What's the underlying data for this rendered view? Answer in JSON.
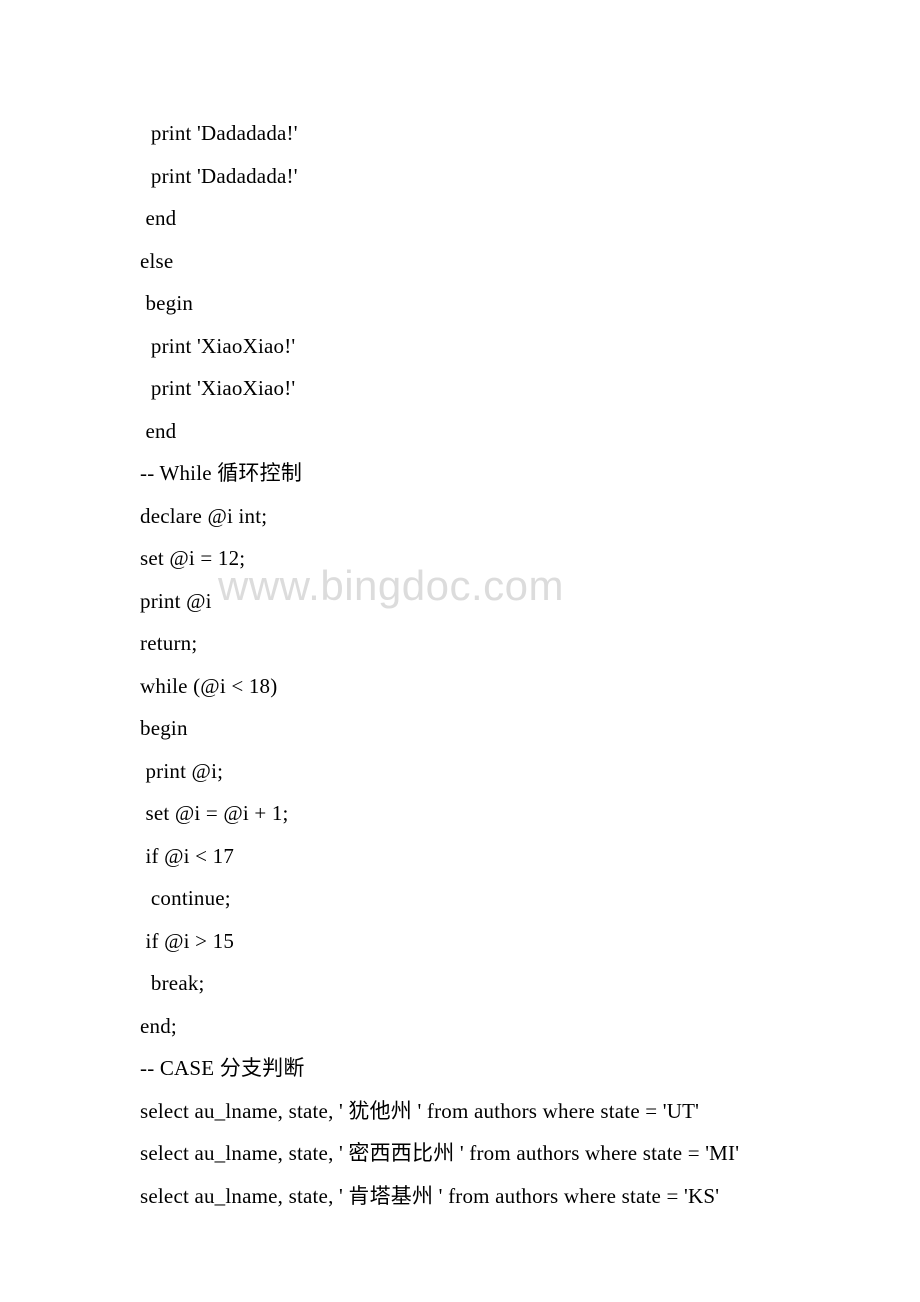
{
  "watermark": "www.bingdoc.com",
  "lines": [
    "  print 'Dadadada!'",
    "  print 'Dadadada!'",
    " end",
    "else",
    " begin",
    "  print 'XiaoXiao!'",
    "  print 'XiaoXiao!'",
    " end",
    "-- While 循环控制",
    "declare @i int;",
    "set @i = 12;",
    "print @i",
    "return;",
    "while (@i < 18)",
    "begin",
    " print @i;",
    " set @i = @i + 1;",
    " if @i < 17",
    "  continue;",
    " if @i > 15",
    "  break;",
    "end;",
    "-- CASE 分支判断",
    "select au_lname, state, ' 犹他州 ' from authors where state = 'UT'",
    "select au_lname, state, ' 密西西比州 ' from authors where state = 'MI'",
    "select au_lname, state, ' 肯塔基州 ' from authors where state = 'KS'"
  ]
}
